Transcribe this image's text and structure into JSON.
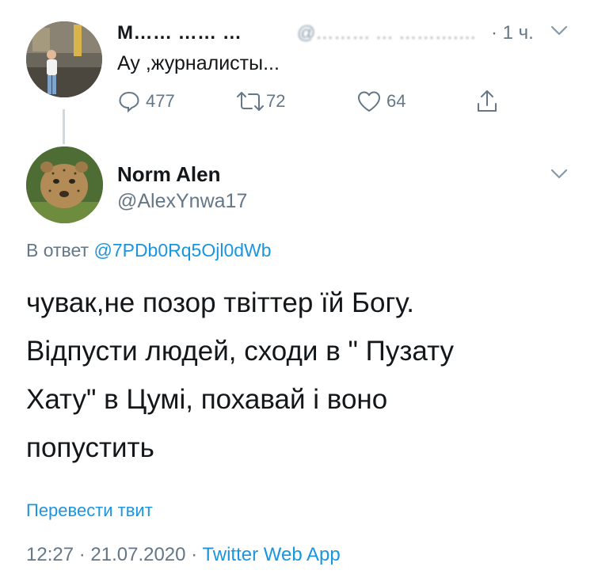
{
  "parent_tweet": {
    "name": "М…… …… …",
    "handle": "@……… … ……….…",
    "time": "· 1 ч.",
    "text": "Ау ,журналисты...",
    "replies": "477",
    "retweets": "72",
    "likes": "64"
  },
  "main_tweet": {
    "name": "Norm Alen",
    "handle": "@AlexYnwa17",
    "reply_prefix": "В ответ",
    "reply_mention": "@7PDb0Rq5Ojl0dWb",
    "text_lines": [
      "чувак,не позор твіттер їй Богу.",
      "Відпусти людей, сходи в \" Пузату",
      "Хату\" в Цумі, похавай і воно",
      "попустить"
    ],
    "translate_label": "Перевести твит",
    "timestamp": "12:27 · 21.07.2020 · ",
    "app": "Twitter Web App"
  },
  "colors": {
    "link": "#1b95e0",
    "secondary": "#657786",
    "text": "#14171a"
  }
}
